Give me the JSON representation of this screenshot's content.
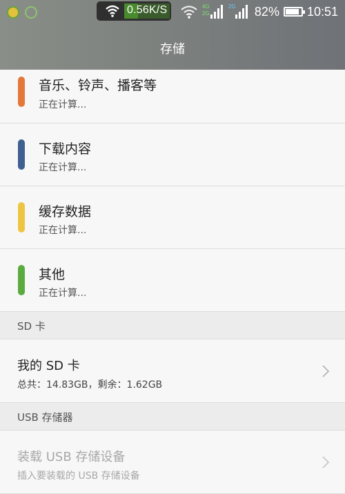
{
  "status_bar": {
    "net_speed": "0.56K/S",
    "battery": "82%",
    "time": "10:51",
    "signal_tags": [
      "4G",
      "2G",
      "2G"
    ],
    "icons": [
      "app-icon-1",
      "app-icon-2",
      "wifi-icon",
      "wifi-icon",
      "signal-icon",
      "signal-icon",
      "battery-icon"
    ]
  },
  "header": {
    "title": "存储"
  },
  "categories": [
    {
      "label": "音乐、铃声、播客等",
      "status": "正在计算...",
      "color": "#e4773a"
    },
    {
      "label": "下载内容",
      "status": "正在计算...",
      "color": "#3f5f91"
    },
    {
      "label": "缓存数据",
      "status": "正在计算...",
      "color": "#eec542"
    },
    {
      "label": "其他",
      "status": "正在计算...",
      "color": "#5aab3f"
    }
  ],
  "sd_section": {
    "header": "SD 卡",
    "item": {
      "title": "我的 SD 卡",
      "subtitle": "总共：14.83GB，剩余：1.62GB"
    }
  },
  "usb_section": {
    "header": "USB 存储器",
    "item": {
      "title": "装载 USB 存储设备",
      "subtitle": "插入要装载的 USB 存储设备"
    }
  }
}
